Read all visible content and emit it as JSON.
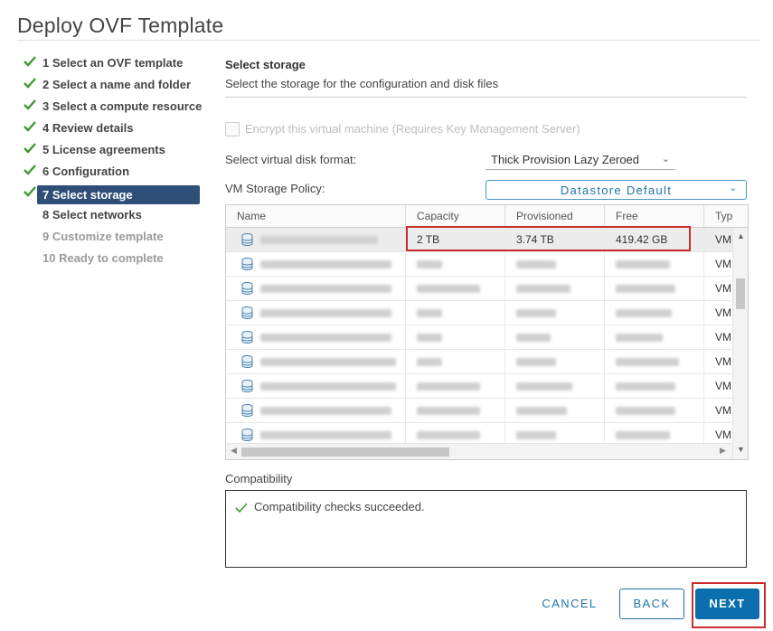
{
  "dialog": {
    "title": "Deploy OVF Template"
  },
  "steps": [
    {
      "label": "1 Select an OVF template",
      "state": "done"
    },
    {
      "label": "2 Select a name and folder",
      "state": "done"
    },
    {
      "label": "3 Select a compute resource",
      "state": "done"
    },
    {
      "label": "4 Review details",
      "state": "done"
    },
    {
      "label": "5 License agreements",
      "state": "done"
    },
    {
      "label": "6 Configuration",
      "state": "done"
    },
    {
      "label": "7 Select storage",
      "state": "active"
    },
    {
      "label": "8 Select networks",
      "state": "todo"
    },
    {
      "label": "9 Customize template",
      "state": "disabled"
    },
    {
      "label": "10 Ready to complete",
      "state": "disabled"
    }
  ],
  "main": {
    "heading": "Select storage",
    "subheading": "Select the storage for the configuration and disk files",
    "encrypt_label": "Encrypt this virtual machine (Requires Key Management Server)",
    "disk_format_label": "Select virtual disk format:",
    "disk_format_value": "Thick Provision Lazy Zeroed",
    "policy_label": "VM Storage Policy:",
    "policy_value": "Datastore Default"
  },
  "grid": {
    "columns": [
      "Name",
      "Capacity",
      "Provisioned",
      "Free",
      "Typ"
    ],
    "selected_row": {
      "capacity": "2 TB",
      "provisioned": "3.74 TB",
      "free": "419.42 GB",
      "type": "VM"
    },
    "other_row_type": "VM"
  },
  "compatibility": {
    "label": "Compatibility",
    "message": "Compatibility checks succeeded."
  },
  "buttons": {
    "cancel": "CANCEL",
    "back": "BACK",
    "next": "NEXT"
  },
  "colors": {
    "accent": "#0b6fae",
    "active_step": "#2f4f78",
    "check": "#3c9a2e",
    "highlight": "#cc2b2b"
  }
}
